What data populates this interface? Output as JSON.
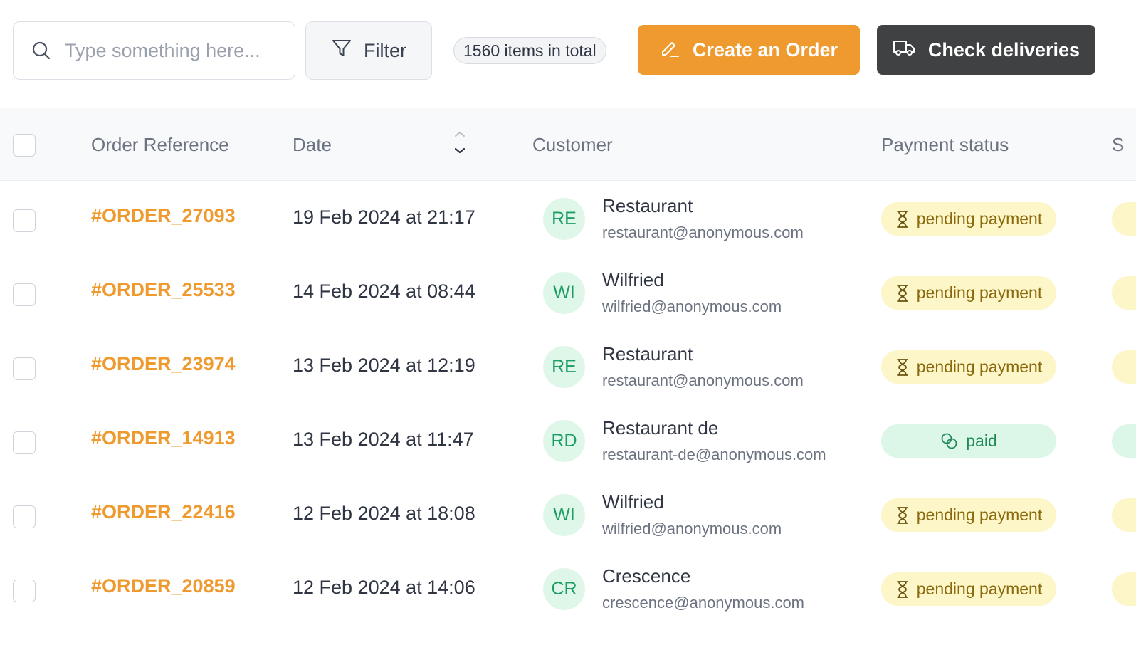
{
  "toolbar": {
    "search_placeholder": "Type something here...",
    "filter_label": "Filter",
    "total_badge": "1560 items in total",
    "create_label": "Create an Order",
    "check_label": "Check deliveries"
  },
  "columns": {
    "order_reference": "Order Reference",
    "date": "Date",
    "customer": "Customer",
    "payment_status": "Payment status",
    "next_col_peek": "S"
  },
  "rows": [
    {
      "ref": "#ORDER_27093",
      "date": "19 Feb 2024 at 21:17",
      "initials": "RE",
      "name": "Restaurant",
      "email": "restaurant@anonymous.com",
      "status": "pending payment",
      "status_type": "pending"
    },
    {
      "ref": "#ORDER_25533",
      "date": "14 Feb 2024 at 08:44",
      "initials": "WI",
      "name": "Wilfried",
      "email": "wilfried@anonymous.com",
      "status": "pending payment",
      "status_type": "pending"
    },
    {
      "ref": "#ORDER_23974",
      "date": "13 Feb 2024 at 12:19",
      "initials": "RE",
      "name": "Restaurant",
      "email": "restaurant@anonymous.com",
      "status": "pending payment",
      "status_type": "pending"
    },
    {
      "ref": "#ORDER_14913",
      "date": "13 Feb 2024 at 11:47",
      "initials": "RD",
      "name": "Restaurant de",
      "email": "restaurant-de@anonymous.com",
      "status": "paid",
      "status_type": "paid"
    },
    {
      "ref": "#ORDER_22416",
      "date": "12 Feb 2024 at 18:08",
      "initials": "WI",
      "name": "Wilfried",
      "email": "wilfried@anonymous.com",
      "status": "pending payment",
      "status_type": "pending"
    },
    {
      "ref": "#ORDER_20859",
      "date": "12 Feb 2024 at 14:06",
      "initials": "CR",
      "name": "Crescence",
      "email": "crescence@anonymous.com",
      "status": "pending payment",
      "status_type": "pending"
    }
  ],
  "colors": {
    "accent": "#ef9a2e",
    "dark_button": "#3f4143",
    "pending_bg": "#fdf6c8",
    "paid_bg": "#dcf6e7",
    "avatar_bg": "#dff7e9"
  },
  "icons": {
    "search": "search-icon",
    "filter": "filter-icon",
    "create": "pencil-icon",
    "check": "truck-icon",
    "pending": "hourglass-icon",
    "paid": "coins-icon",
    "sort": "sort-icon"
  }
}
